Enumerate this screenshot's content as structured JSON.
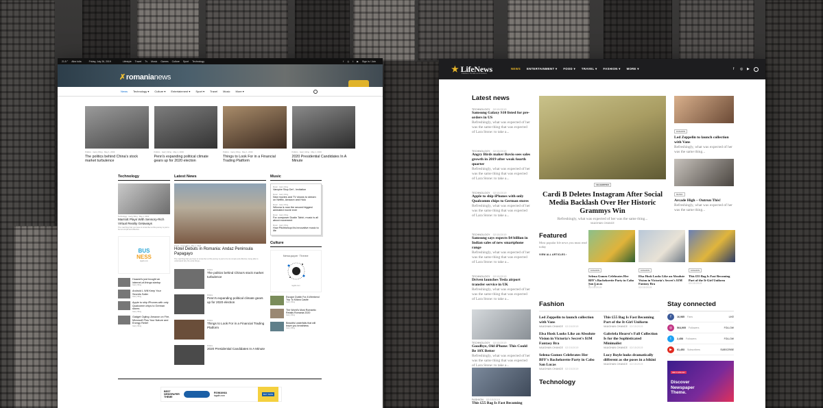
{
  "romania": {
    "top": {
      "weather": "21.5 °",
      "city": "Alba Iulia",
      "date": "Friday, July 26, 2019",
      "links": [
        "Lifestyle",
        "Travel",
        "Tv",
        "Music",
        "Games",
        "Culture",
        "Sport",
        "Technology"
      ],
      "signin": "Sign in / Join"
    },
    "logo_a": "romania",
    "logo_b": "news",
    "nav": [
      "News",
      "Technology ▾",
      "Culture ▾",
      "Entertainment ▾",
      "Sport ▾",
      "Travel",
      "Music",
      "More ▾"
    ],
    "featured": [
      {
        "cat": "Politics · Garry Wing · May 1, 2019",
        "title": "The politics behind China's stock market turbulence"
      },
      {
        "cat": "Politics · Garry Wing · May 1, 2019",
        "title": "Penn's expanding political climate gears up for 2020 election"
      },
      {
        "cat": "Politics · Garry Wing · May 1, 2019",
        "title": "Things to Look For in a Financial Trading Platform"
      },
      {
        "cat": "Politics · Garry Wing · May 1, 2019",
        "title": "2020 Presidential Candidates In A Minute"
      }
    ],
    "tech_heading": "Technology",
    "tech_main": {
      "meta": "Technology · Garry Wing · May 1, 2019",
      "title": "Marriott Plays With Sensory-Rich Virtual Reality Getaways",
      "excerpt": "The marching that you have to remember at this journey is just to be too simple and effective."
    },
    "tech_list": [
      {
        "title": "Huawei's just bought an internet-of-things startup",
        "meta": "Garry Wing"
      },
      {
        "title": "Android L Will Keep Your Secrets Safer",
        "meta": "Garry Wing"
      },
      {
        "title": "Apple to ship iPhones with only Qualcomm chips to German stores",
        "meta": "Garry Wing"
      },
      {
        "title": "Gadget Ogling: Amazon on Fire, Microsoft Plus Your Nature and Energy Relief",
        "meta": "Garry Wing"
      }
    ],
    "latest_heading": "Latest News",
    "latest_main": {
      "meta": "Travel · Garry Wing · May 1, 2019",
      "title": "Hotel Debuts in Romania: Andaz Peninsula Papagayo",
      "excerpt": "The marching that you have to remember at this journey is just to be too simple and effective, being able to understand why the extra things..."
    },
    "latest_list": [
      {
        "cat": "Politics",
        "title": "The politics behind China's stock market turbulence"
      },
      {
        "cat": "Politics",
        "title": "Penn's expanding political climate gears up for 2020 election"
      },
      {
        "cat": "Politics",
        "title": "Things to Look For in a Financial Trading Platform"
      },
      {
        "cat": "Politics",
        "title": "2020 Presidential Candidates In A Minute"
      }
    ],
    "music_heading": "Music",
    "music_list": [
      {
        "meta": "Music · Garry Wing",
        "title": "Vampire Stop Def - Invitation"
      },
      {
        "meta": "Music · Garry Wing",
        "title": "New movies and TV shows to stream on Netflix, Amazon and Hulu"
      },
      {
        "meta": "Music · Garry Wing",
        "title": "Winona is now the second biggest animated movie ever"
      },
      {
        "meta": "Music · Garry Wing",
        "title": "For composer Dustin Tahiri, music is all about movement"
      },
      {
        "meta": "Music · Garry Wing",
        "title": "How Pitchforkopi its innovative music to life"
      }
    ],
    "culture_heading": "Culture",
    "culture_poster": "Newspaper Theme",
    "culture_poster_url": "tagdiv.com",
    "culture_list": [
      {
        "title": "Escape Dublin For A Weekend Trip To Kilkea Castle",
        "meta": "Garry Wing"
      },
      {
        "title": "The World's Most Romantic Retails Romania 2020",
        "meta": "Garry Wing"
      },
      {
        "title": "Beautiful waterfalls that will leave you breathless",
        "meta": "Garry Wing"
      }
    ],
    "ad_left_1": "BEST",
    "ad_left_2": "NEWSPAPER",
    "ad_left_3": "THEME",
    "ad_mid_1": "ROMANIA",
    "ad_mid_2": "tagdiv.com",
    "ad_btn": "BUY NOW",
    "promo_1": "BUS",
    "promo_2": "NESS",
    "promo_url": "tagdiv.com"
  },
  "life": {
    "logo": "LifeNews",
    "tagline": "Fashion Trends and Culture",
    "nav": [
      "NEWS",
      "ENTERTAINMENT ▾",
      "FOOD ▾",
      "TRAVEL ▾",
      "FASHION ▾",
      "MORE ▾"
    ],
    "latest_heading": "Latest news",
    "latest": [
      {
        "cat": "TECHNOLOGY",
        "date": "02/15/2019",
        "title": "Samsung Galaxy S10 listed for pre-orders in US",
        "text": "Refreshingly, what was expected of her was the same thing that was expected of Lara Stone: to take a..."
      },
      {
        "cat": "TECHNOLOGY",
        "date": "02/15/2019",
        "title": "Angry Birds maker Rovio sees sales growth in 2019 after weak fourth quarter",
        "text": "Refreshingly, what was expected of her was the same thing that was expected of Lara Stone: to take a..."
      },
      {
        "cat": "TECHNOLOGY",
        "date": "02/15/2019",
        "title": "Apple to ship iPhones with only Qualcomm chips to German stores",
        "text": "Refreshingly, what was expected of her was the same thing that was expected of Lara Stone: to take a..."
      },
      {
        "cat": "TECHNOLOGY",
        "date": "02/15/2019",
        "title": "Samsung says expects $4 billion in Indian sales of new smartphone range",
        "text": "Refreshingly, what was expected of her was the same thing that was expected of Lara Stone: to take a..."
      },
      {
        "cat": "TECHNOLOGY",
        "date": "02/15/2019",
        "title": "Driven launches Tesla airport transfer service in UK",
        "text": "Refreshingly, what was expected of her was the same thing that was expected of Lara Stone: to take a..."
      },
      {
        "cat": "TECHNOLOGY",
        "date": "02/15/2019",
        "title": "Goodbye, Old iPhone: This Could Be 10X Better",
        "text": "Refreshingly, what was expected of her was the same thing that was expected of Lara Stone: to take a..."
      },
      {
        "cat": "FASHION",
        "date": "02/15/2019",
        "title": "This £55 Bag Is Fast Becoming"
      }
    ],
    "hero": {
      "badge": "CELEBRITIES",
      "title": "Cardi B Deletes Instagram After Social Media Backlash Over Her Historic Grammys Win",
      "text": "Refreshingly, what was expected of her was the same thing...",
      "author": "VAUGHAN CHANCE"
    },
    "side": [
      {
        "badge": "FASHION",
        "title": "Led Zeppelin to launch collection with Vans",
        "text": "Refreshingly, what was expected of her was the same thing..."
      },
      {
        "badge": "MUSIC",
        "title": "Arcade High – Outrun This!",
        "text": "Refreshingly, what was expected of her was the same thing..."
      }
    ],
    "featured_heading": "Featured",
    "featured_sub": "Most popular life news you must read today",
    "featured_link": "VIEW ALL ARTICLES",
    "featured_arrow": "›",
    "featured": [
      {
        "badge": "FASHION",
        "title": "Selena Gomez Celebrates Her BFF's Bachelorette Party in Cabo San Lucas",
        "date": "02/15/2019"
      },
      {
        "badge": "FASHION",
        "title": "Elsa Hosk Looks Like an Absolute Vision in Victoria's Secret's $1M Fantasy Bra",
        "date": "02/15/2019"
      },
      {
        "badge": "FASHION",
        "title": "This £55 Bag Is Fast Becoming Part of the It-Girl Uniform",
        "date": "02/15/2019"
      }
    ],
    "prev_arrow": "‹",
    "next_arrow": "›",
    "fashion_heading": "Fashion",
    "fashion": [
      {
        "title": "Led Zeppelin to launch collection with Vans",
        "author": "VAUGHAN CHANCE",
        "date": "02/15/2019"
      },
      {
        "title": "This £55 Bag Is Fast Becoming Part of the It-Girl Uniform",
        "author": "VAUGHAN CHANCE",
        "date": "02/15/2019"
      },
      {
        "title": "Elsa Hosk Looks Like an Absolute Vision in Victoria's Secret's $1M Fantasy Bra",
        "author": "VAUGHAN CHANCE",
        "date": "02/15/2019"
      },
      {
        "title": "Gabriela Hearst's Fall Collection Is for the Sophisticated Minimalist",
        "author": "VAUGHAN CHANCE",
        "date": "02/15/2019"
      },
      {
        "title": "Selena Gomez Celebrates Her BFF's Bachelorette Party in Cabo San Lucas",
        "author": "VAUGHAN CHANCE",
        "date": "02/15/2019"
      },
      {
        "title": "Lucy Boyle looks dramatically different as she poses in a bikini",
        "author": "VAUGHAN CHANCE",
        "date": "02/15/2019"
      }
    ],
    "technology_heading": "Technology",
    "stay_heading": "Stay connected",
    "social": [
      {
        "count": "16,985",
        "label": "Fans",
        "action": "LIKE",
        "color": "#3b5998",
        "icon": "f"
      },
      {
        "count": "564,905",
        "label": "Followers",
        "action": "FOLLOW",
        "color": "#c13584",
        "icon": "◎"
      },
      {
        "count": "2,458",
        "label": "Followers",
        "action": "FOLLOW",
        "color": "#1da1f2",
        "icon": "t"
      },
      {
        "count": "61,453",
        "label": "Subscribers",
        "action": "SUBSCRIBE",
        "color": "#e02a20",
        "icon": "▶"
      }
    ],
    "ad_tag": "300 X 250 AD",
    "ad_1": "Discover",
    "ad_2": "Newspaper",
    "ad_3": "Theme."
  }
}
